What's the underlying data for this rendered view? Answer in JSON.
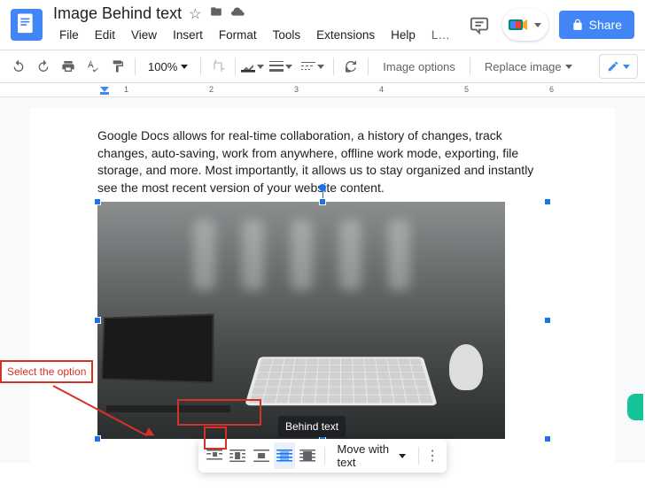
{
  "header": {
    "title": "Image Behind text",
    "menus": [
      "File",
      "Edit",
      "View",
      "Insert",
      "Format",
      "Tools",
      "Extensions",
      "Help",
      "L…"
    ],
    "share_label": "Share"
  },
  "toolbar": {
    "zoom": "100%",
    "image_options": "Image options",
    "replace_image": "Replace image"
  },
  "ruler": {
    "marks": [
      "1",
      "2",
      "3",
      "4",
      "5",
      "6"
    ]
  },
  "document": {
    "body_text": "Google Docs allows for real-time collaboration, a history of changes, track changes, auto-saving, work from anywhere, offline work mode, exporting, file storage, and more. Most importantly, it allows us to stay organized and instantly see the most recent version of your website content."
  },
  "image_toolbar": {
    "tooltip": "Behind text",
    "move_label": "Move with text",
    "wrap_options": [
      "inline",
      "wrap",
      "break",
      "behind",
      "front"
    ]
  },
  "annotation": {
    "label": "Select the option"
  }
}
